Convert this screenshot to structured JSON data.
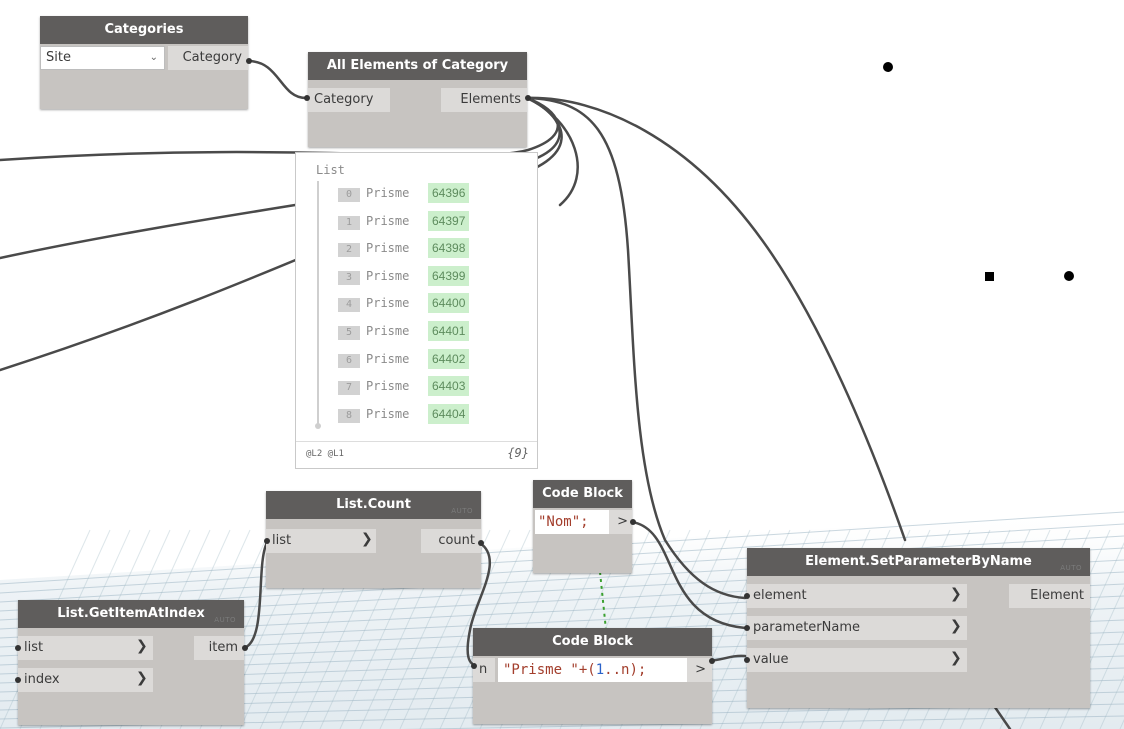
{
  "canvas": {
    "annotation_marks": [
      "dot",
      "square",
      "dot"
    ]
  },
  "nodes": {
    "categories": {
      "title": "Categories",
      "dropdown_value": "Site",
      "dropdown_icon": "chevron-down-icon",
      "output": "Category"
    },
    "all_elements": {
      "title": "All Elements of Category",
      "input": "Category",
      "output": "Elements"
    },
    "list_count": {
      "title": "List.Count",
      "input": "list",
      "output": "count",
      "lacing": "AUTO"
    },
    "code_block_1": {
      "title": "Code Block",
      "code": "\"Nom\";",
      "output": ">"
    },
    "code_block_2": {
      "title": "Code Block",
      "input": "n",
      "code_string": "\"Prisme \"",
      "code_rest": "+(",
      "code_num": "1",
      "code_tail": "..n);",
      "output": ">"
    },
    "get_item": {
      "title": "List.GetItemAtIndex",
      "inputs": [
        "list",
        "index"
      ],
      "output": "item",
      "lacing": "AUTO"
    },
    "set_param": {
      "title": "Element.SetParameterByName",
      "inputs": [
        "element",
        "parameterName",
        "value"
      ],
      "output": "Element",
      "lacing": "AUTO"
    }
  },
  "watch": {
    "header": "List",
    "items": [
      {
        "index": "0",
        "name": "Prisme",
        "value": "64396"
      },
      {
        "index": "1",
        "name": "Prisme",
        "value": "64397"
      },
      {
        "index": "2",
        "name": "Prisme",
        "value": "64398"
      },
      {
        "index": "3",
        "name": "Prisme",
        "value": "64399"
      },
      {
        "index": "4",
        "name": "Prisme",
        "value": "64400"
      },
      {
        "index": "5",
        "name": "Prisme",
        "value": "64401"
      },
      {
        "index": "6",
        "name": "Prisme",
        "value": "64402"
      },
      {
        "index": "7",
        "name": "Prisme",
        "value": "64403"
      },
      {
        "index": "8",
        "name": "Prisme",
        "value": "64404"
      }
    ],
    "levels": "@L2 @L1",
    "count": "{9}"
  },
  "colors": {
    "node_title": "#5f5d5c",
    "node_body": "#c7c4c1",
    "port_bg": "#dcdad8",
    "wire": "#4a4a4a",
    "value_bg": "#ccefcc",
    "code_string": "#a33e2c",
    "code_number": "#2a62c9",
    "grid_line": "#3aa02f"
  }
}
